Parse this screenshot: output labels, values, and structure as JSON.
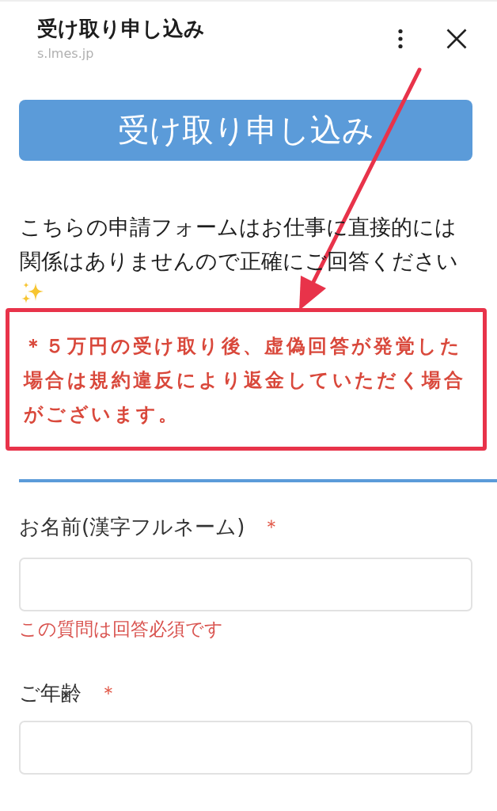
{
  "header": {
    "title": "受け取り申し込み",
    "url": "s.lmes.jp"
  },
  "banner": {
    "title": "受け取り申し込み"
  },
  "intro": {
    "text": "こちらの申請フォームはお仕事に直接的には関係はありませんので正確にご回答ください"
  },
  "notice": {
    "text": "＊５万円の受け取り後、虚偽回答が発覚した場合は規約違反により返金していただく場合がございます。",
    "highlighted": true
  },
  "fields": [
    {
      "label": "お名前(漢字フルネーム)",
      "required_mark": "＊",
      "error": "この質問は回答必須です"
    },
    {
      "label": "ご年齢",
      "required_mark": "＊"
    }
  ]
}
